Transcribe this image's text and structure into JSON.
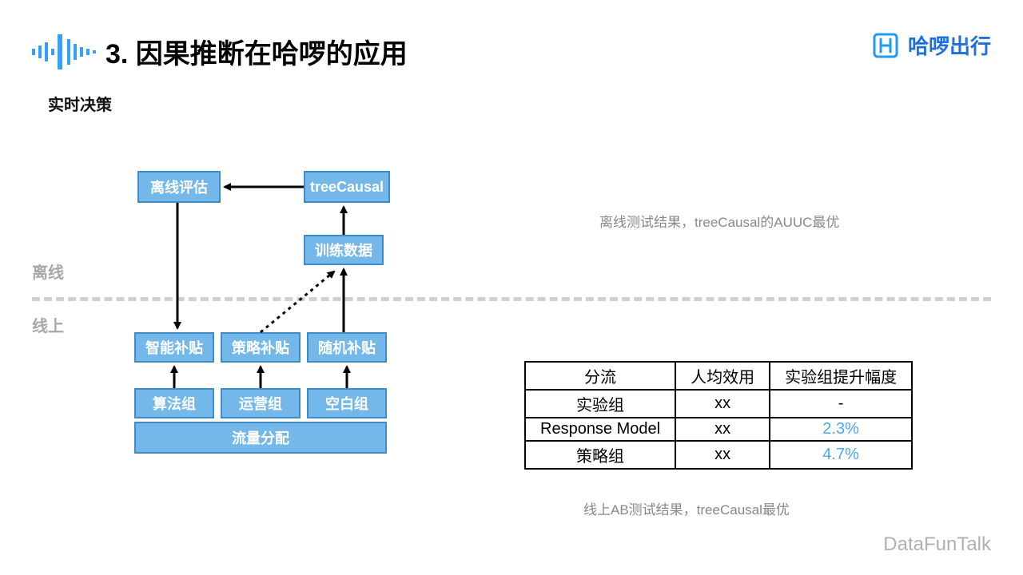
{
  "title": "3. 因果推断在哈啰的应用",
  "brand_name": "哈啰出行",
  "subtitle": "实时决策",
  "offline_label": "离线",
  "online_label": "线上",
  "boxes": {
    "offline_eval": "离线评估",
    "treecausal": "treeCausal",
    "traindata": "训练数据",
    "smart": "智能补贴",
    "strategy": "策略补贴",
    "random": "随机补贴",
    "algo": "算法组",
    "ops": "运营组",
    "blank": "空白组",
    "traffic": "流量分配"
  },
  "note1": "离线测试结果，treeCausal的AUUC最优",
  "note2": "线上AB测试结果，treeCausal最优",
  "table": {
    "headers": [
      "分流",
      "人均效用",
      "实验组提升幅度"
    ],
    "rows": [
      {
        "c0": "实验组",
        "c1": "xx",
        "c2": "-",
        "hl": false
      },
      {
        "c0": "Response Model",
        "c1": "xx",
        "c2": "2.3%",
        "hl": true
      },
      {
        "c0": "策略组",
        "c1": "xx",
        "c2": "4.7%",
        "hl": true
      }
    ]
  },
  "watermark": "DataFunTalk"
}
